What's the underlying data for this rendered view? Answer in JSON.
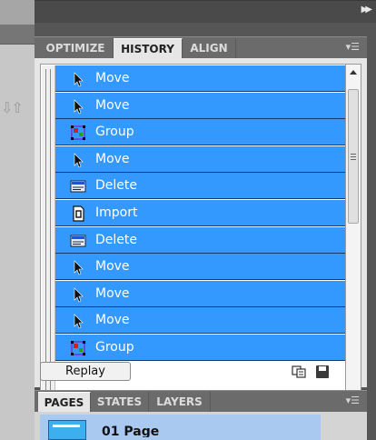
{
  "window": {
    "collapse_icon": "double-chevron-right-icon",
    "left_icon": "sort-arrows-icon"
  },
  "history_panel": {
    "tabs": [
      {
        "label": "OPTIMIZE"
      },
      {
        "label": "HISTORY"
      },
      {
        "label": "ALIGN"
      }
    ],
    "active_tab": "HISTORY",
    "menu_icon": "panel-menu-icon",
    "rows": [
      {
        "label": "Move",
        "icon": "arrow-cursor-icon"
      },
      {
        "label": "Move",
        "icon": "arrow-cursor-icon"
      },
      {
        "label": "Group",
        "icon": "group-icon"
      },
      {
        "label": "Move",
        "icon": "arrow-cursor-icon"
      },
      {
        "label": "Delete",
        "icon": "delete-icon"
      },
      {
        "label": "Import",
        "icon": "import-icon"
      },
      {
        "label": "Delete",
        "icon": "delete-icon"
      },
      {
        "label": "Move",
        "icon": "arrow-cursor-icon"
      },
      {
        "label": "Move",
        "icon": "arrow-cursor-icon"
      },
      {
        "label": "Move",
        "icon": "arrow-cursor-icon"
      },
      {
        "label": "Group",
        "icon": "group-icon"
      }
    ],
    "replay_label": "Replay",
    "copy_icon": "copy-steps-icon",
    "save_icon": "save-steps-icon",
    "colors": {
      "selection": "#3399ff",
      "row_divider": "#1a3a66"
    }
  },
  "bottom_panel": {
    "tabs": [
      {
        "label": "PAGES"
      },
      {
        "label": "STATES"
      },
      {
        "label": "LAYERS"
      }
    ],
    "active_tab": "PAGES",
    "page_name": "01 Page"
  }
}
